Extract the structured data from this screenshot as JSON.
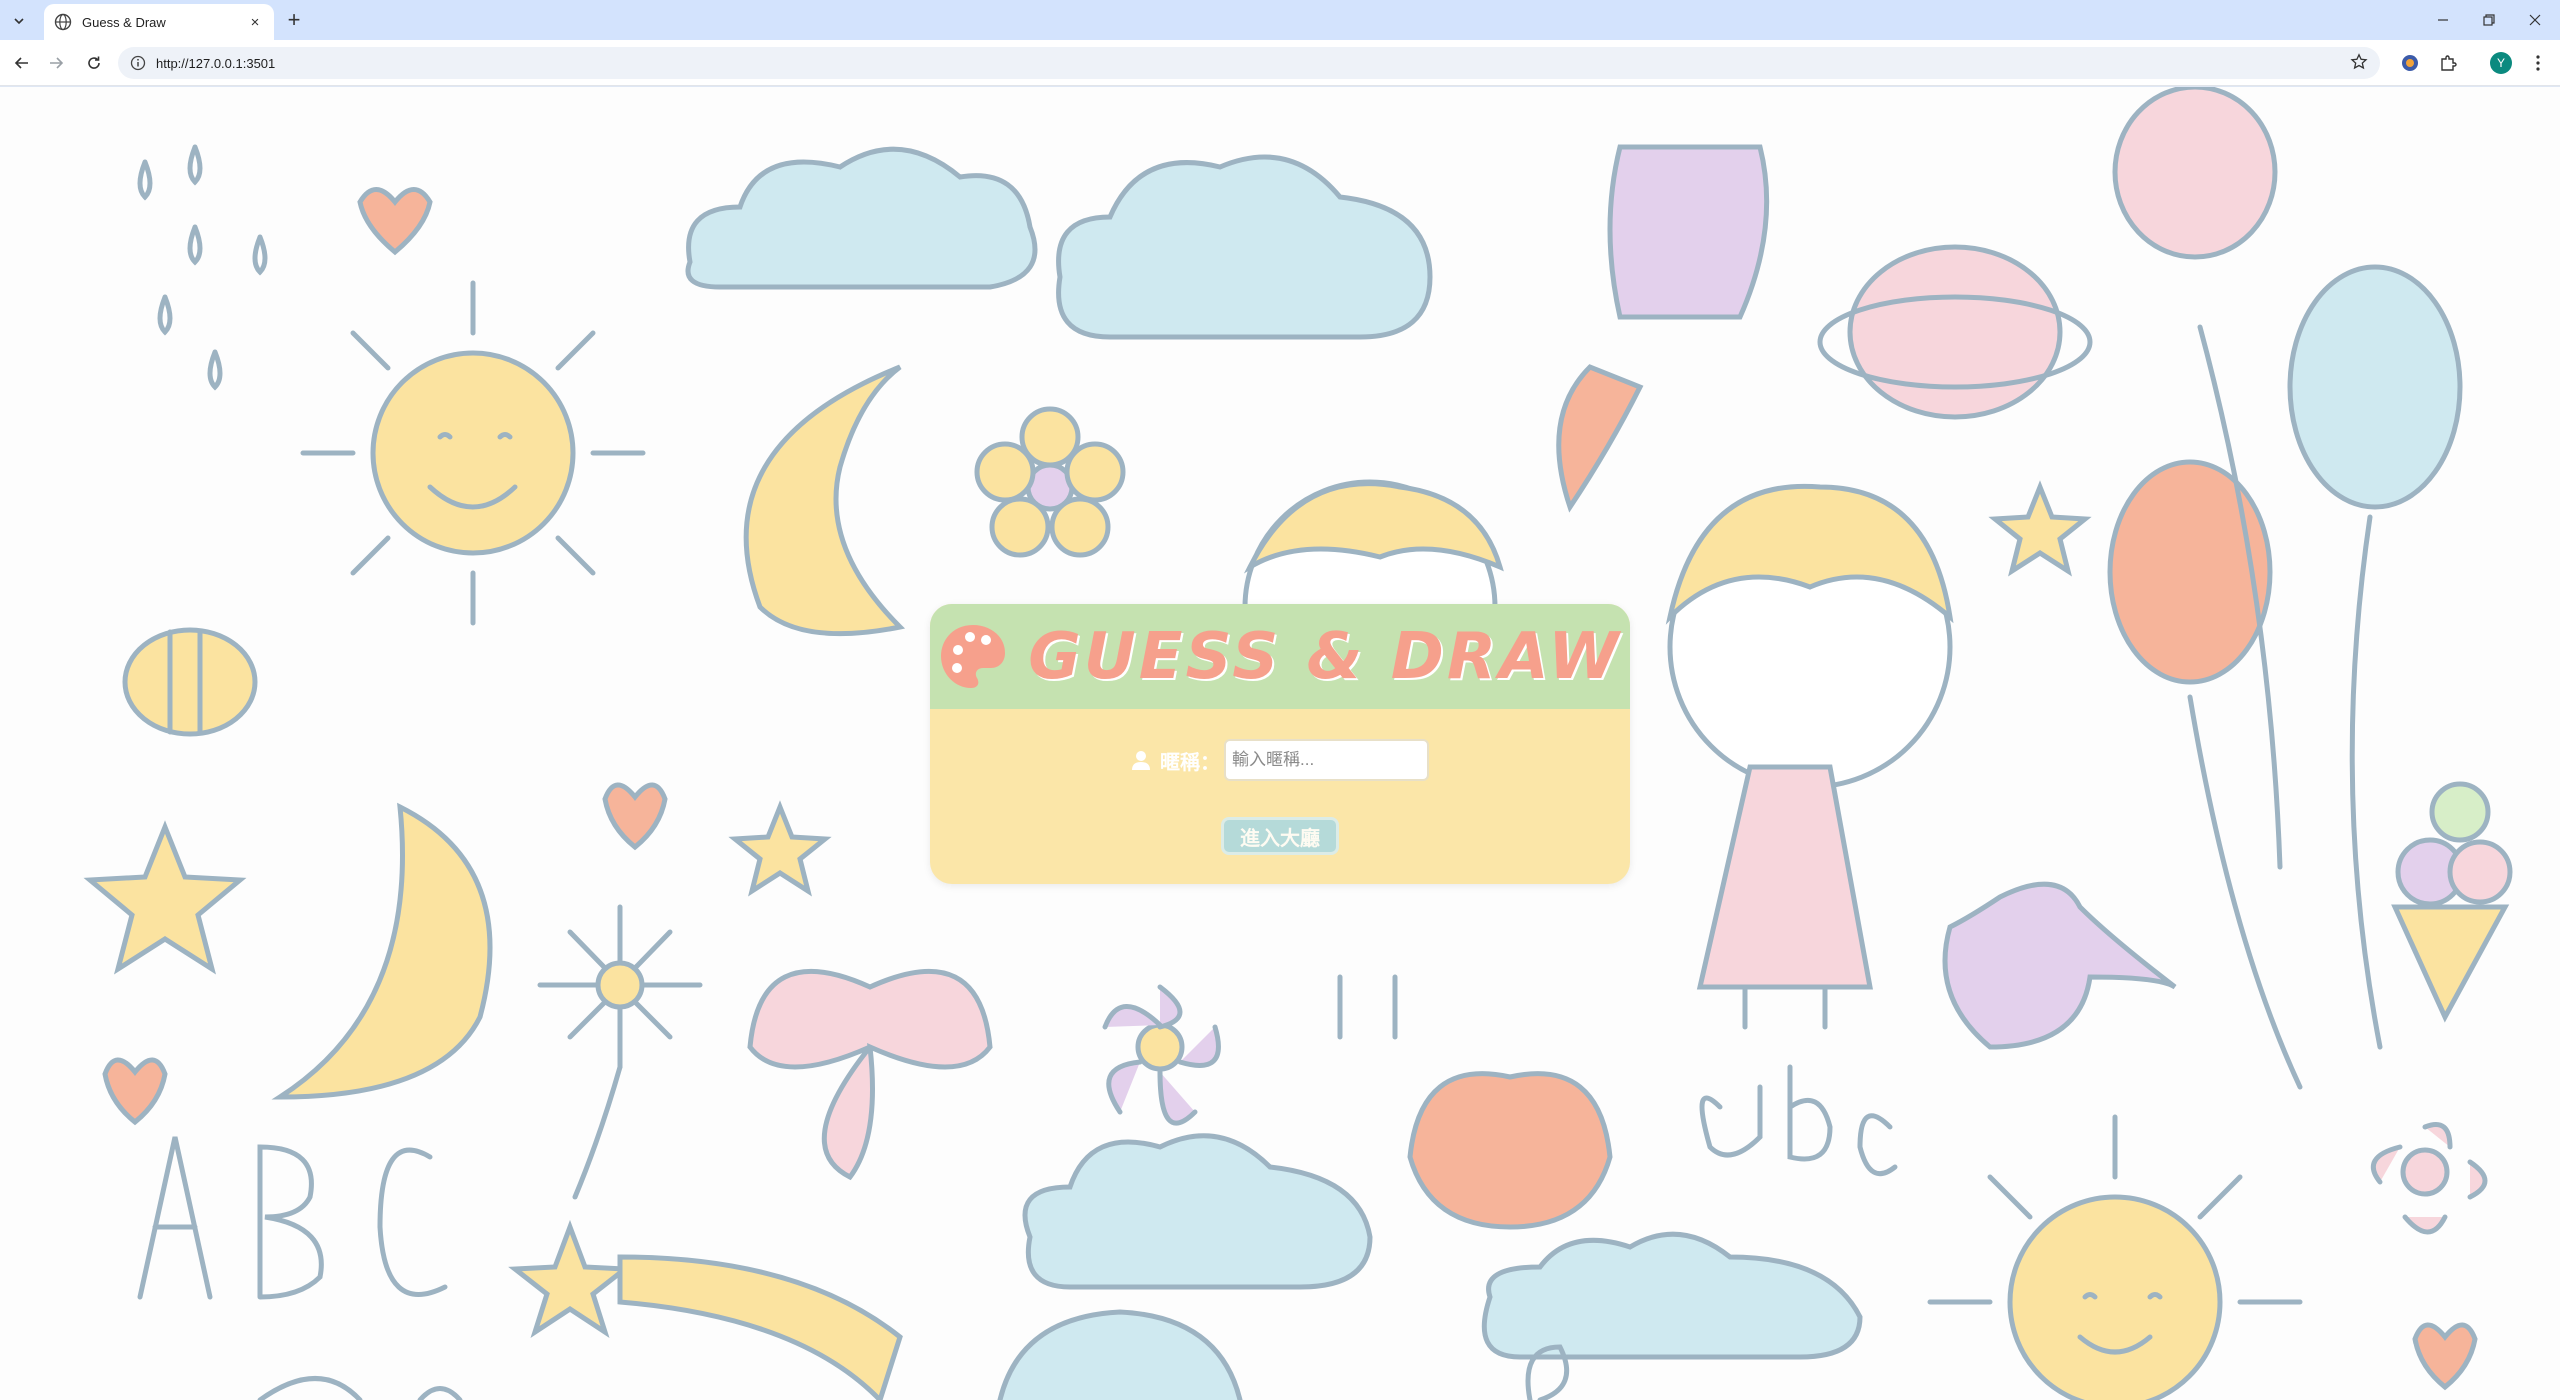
{
  "browser": {
    "tab_title": "Guess & Draw",
    "tab_close": "×",
    "new_tab": "+",
    "url": "http://127.0.0.1:3501",
    "profile_initial": "Y"
  },
  "app": {
    "brand": "GUESS & DRAW",
    "nickname_label": "暱稱：",
    "nickname_placeholder": "輸入暱稱...",
    "enter_button": "進入大廳"
  },
  "colors": {
    "header_green": "#c5e2b0",
    "card_yellow": "#fbe6a8",
    "brand_salmon": "#f6a08c",
    "button_blue": "#a9d8e2"
  }
}
